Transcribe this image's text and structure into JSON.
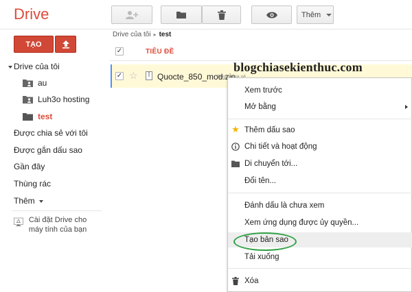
{
  "app": {
    "name": "Drive"
  },
  "toolbar": {
    "more_label": "Thêm"
  },
  "left": {
    "create_label": "TẠO",
    "my_drive": "Drive của tôi",
    "folders": [
      "au",
      "Luh3o hosting",
      "test"
    ],
    "nav": [
      "Được chia sẻ với tôi",
      "Được gắn dấu sao",
      "Gần đây",
      "Thùng rác"
    ],
    "more": "Thêm",
    "install": "Cài đặt Drive cho máy tính của bạn"
  },
  "content": {
    "breadcrumb": [
      "Drive của tôi",
      "test"
    ],
    "column_title": "TIÊU ĐỀ",
    "file": {
      "name": "Quocte_850_mod.zip",
      "shared": "Được chia sẻ"
    }
  },
  "watermark": "blogchiasekienthuc.com",
  "menu": {
    "items": [
      "Xem trước",
      "Mở bằng",
      "Thêm dấu sao",
      "Chi tiết và hoạt động",
      "Di chuyển tới...",
      "Đổi tên...",
      "Đánh dấu là chưa xem",
      "Xem ứng dụng được ủy quyền...",
      "Tạo bản sao",
      "Tải xuống",
      "Xóa"
    ]
  },
  "colors": {
    "brand_red": "#dd4b39",
    "button_red": "#d14836",
    "highlight_oval": "#2ea043",
    "selected_row": "#fff9d7"
  }
}
